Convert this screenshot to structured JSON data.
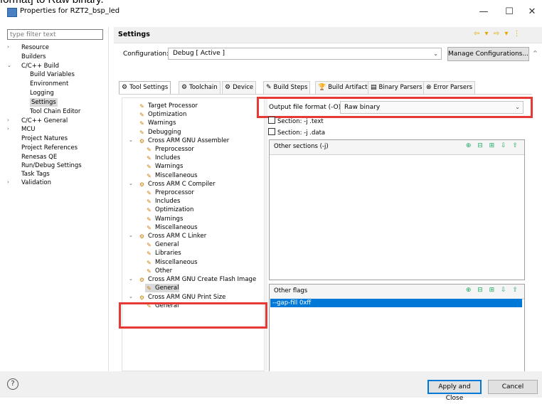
{
  "caption": "format] to Raw binary.",
  "window": {
    "title": "Properties for RZT2_bsp_led",
    "minimize": "—",
    "maximize": "☐",
    "close": "✕"
  },
  "filter": {
    "placeholder": "type filter text"
  },
  "left_tree": [
    {
      "label": "Resource",
      "arrow": "›"
    },
    {
      "label": "Builders",
      "arrow": ""
    },
    {
      "label": "C/C++ Build",
      "arrow": "⌄"
    },
    {
      "label": "Build Variables",
      "arrow": ""
    },
    {
      "label": "Environment",
      "arrow": ""
    },
    {
      "label": "Logging",
      "arrow": ""
    },
    {
      "label": "Settings",
      "arrow": ""
    },
    {
      "label": "Tool Chain Editor",
      "arrow": ""
    },
    {
      "label": "C/C++ General",
      "arrow": "›"
    },
    {
      "label": "MCU",
      "arrow": "›"
    },
    {
      "label": "Project Natures",
      "arrow": ""
    },
    {
      "label": "Project References",
      "arrow": ""
    },
    {
      "label": "Renesas QE",
      "arrow": ""
    },
    {
      "label": "Run/Debug Settings",
      "arrow": ""
    },
    {
      "label": "Task Tags",
      "arrow": ""
    },
    {
      "label": "Validation",
      "arrow": "›"
    }
  ],
  "settings": {
    "title": "Settings",
    "nav": "⇦ ▾ ⇨ ▾ ⋮",
    "config_label": "Configuration:",
    "config_value": "Debug  [ Active ]",
    "manage_button": "Manage Configurations..."
  },
  "tabs": [
    {
      "label": "Tool Settings",
      "icon": "⚙"
    },
    {
      "label": "Toolchain",
      "icon": "⚙"
    },
    {
      "label": "Device",
      "icon": "⚙"
    },
    {
      "label": "Build Steps",
      "icon": "✎"
    },
    {
      "label": "Build Artifact",
      "icon": "🏆"
    },
    {
      "label": "Binary Parsers",
      "icon": "▤"
    },
    {
      "label": "Error Parsers",
      "icon": "⊗"
    }
  ],
  "tool_tree": [
    {
      "label": "Target Processor"
    },
    {
      "label": "Optimization"
    },
    {
      "label": "Warnings"
    },
    {
      "label": "Debugging"
    },
    {
      "label": "Cross ARM GNU Assembler"
    },
    {
      "label": "Preprocessor"
    },
    {
      "label": "Includes"
    },
    {
      "label": "Warnings"
    },
    {
      "label": "Miscellaneous"
    },
    {
      "label": "Cross ARM C Compiler"
    },
    {
      "label": "Preprocessor"
    },
    {
      "label": "Includes"
    },
    {
      "label": "Optimization"
    },
    {
      "label": "Warnings"
    },
    {
      "label": "Miscellaneous"
    },
    {
      "label": "Cross ARM C Linker"
    },
    {
      "label": "General"
    },
    {
      "label": "Libraries"
    },
    {
      "label": "Miscellaneous"
    },
    {
      "label": "Other"
    },
    {
      "label": "Cross ARM GNU Create Flash Image"
    },
    {
      "label": "General"
    },
    {
      "label": "Cross ARM GNU Print Size"
    },
    {
      "label": "General"
    }
  ],
  "output": {
    "label": "Output file format (-O)",
    "value": "Raw binary",
    "section_text": "Section: -j .text",
    "section_data": "Section: -j .data",
    "other_sections": "Other sections (-j)",
    "other_flags": "Other flags",
    "flag_value": "--gap-fill 0xff",
    "group_icons": "⊕ ⊟ ⊞ ⇩ ⇧"
  },
  "footer": {
    "help": "?",
    "apply": "Apply and Close",
    "cancel": "Cancel"
  },
  "colors": {
    "highlight": "#e53935",
    "selection": "#0078d7"
  }
}
